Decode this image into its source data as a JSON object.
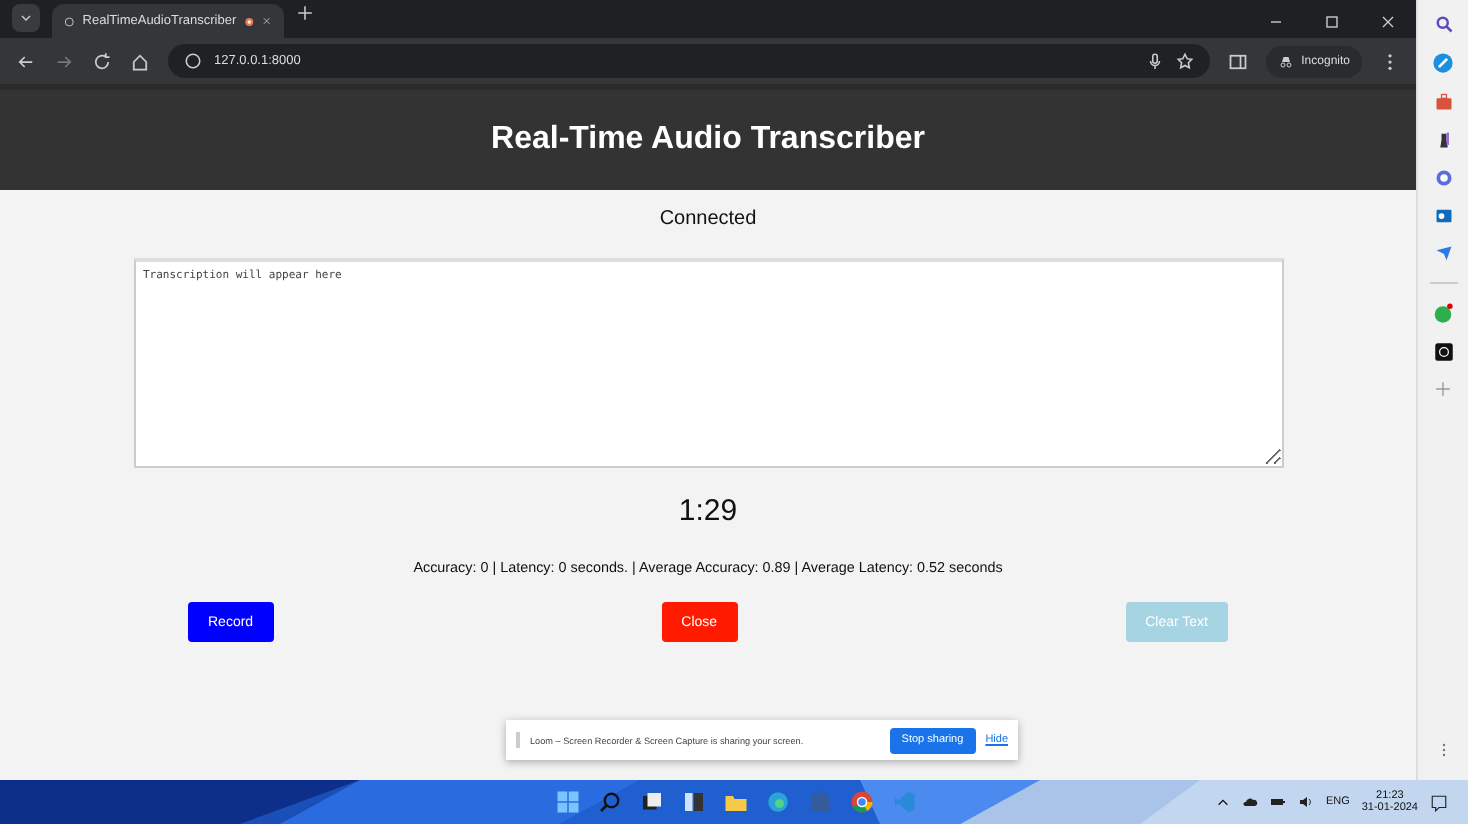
{
  "browser": {
    "tab_title": "RealTimeAudioTranscriber",
    "url": "127.0.0.1:8000",
    "profile": "Incognito"
  },
  "page": {
    "title": "Real-Time Audio Transcriber",
    "status": "Connected",
    "transcript": {
      "placeholder": "Transcription will appear here"
    },
    "timer": "1:29",
    "stats": "Accuracy: 0 | Latency: 0 seconds. | Average Accuracy: 0.89 | Average Latency: 0.52 seconds",
    "buttons": [
      {
        "label": "Record",
        "kind": "record"
      },
      {
        "label": "Close",
        "kind": "close"
      },
      {
        "label": "Clear Text",
        "kind": "clear"
      }
    ]
  },
  "share_bar": {
    "message": "Loom – Screen Recorder & Screen Capture is sharing your screen.",
    "stop": "Stop sharing",
    "hide": "Hide"
  },
  "taskbar": {
    "language": "ENG",
    "time": "21:23",
    "date": "31-01-2024"
  }
}
